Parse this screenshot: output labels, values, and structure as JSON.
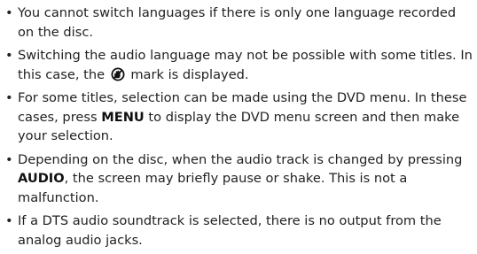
{
  "bullet_glyph": "•",
  "items": [
    {
      "text": "You cannot switch languages if there is only one language recorded on the disc."
    },
    {
      "before": "Switching the audio language may not be possible with some titles. In this case, the ",
      "icon": "prohibited-hand-icon",
      "after": " mark is displayed."
    },
    {
      "line1": "For some titles, selection can be made using the DVD menu.",
      "before": " In these cases, press ",
      "bold": "MENU",
      "after": " to display the DVD menu screen and then make your selection."
    },
    {
      "before": "Depending on the disc, when the audio track is changed by pressing ",
      "bold": "AUDIO",
      "after": ", the screen may briefly pause or shake. This is not a malfunction."
    },
    {
      "text": "If a DTS audio soundtrack is selected, there is no output from the analog audio jacks."
    }
  ]
}
